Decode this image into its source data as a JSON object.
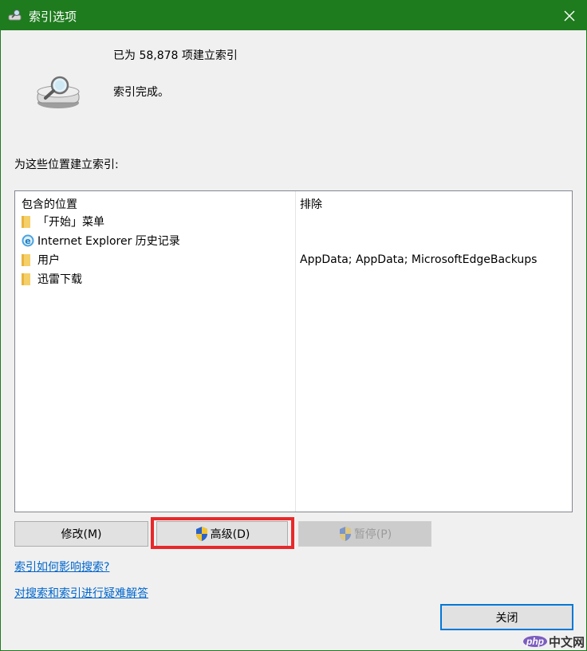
{
  "window": {
    "title": "索引选项",
    "close_glyph": "✕"
  },
  "status": {
    "count_text": "已为 58,878 项建立索引",
    "state_text": "索引完成。"
  },
  "locations": {
    "section_label": "为这些位置建立索引:",
    "headers": {
      "included": "包含的位置",
      "excluded": "排除"
    },
    "rows": [
      {
        "icon": "folder-icon",
        "name": "「开始」菜单",
        "exclude": ""
      },
      {
        "icon": "ie-icon",
        "name": "Internet Explorer 历史记录",
        "exclude": ""
      },
      {
        "icon": "folder-icon",
        "name": "用户",
        "exclude": "AppData; AppData; MicrosoftEdgeBackups"
      },
      {
        "icon": "folder-icon",
        "name": "迅雷下载",
        "exclude": ""
      }
    ]
  },
  "buttons": {
    "modify": "修改(M)",
    "advanced": "高级(D)",
    "pause": "暂停(P)",
    "close": "关闭"
  },
  "links": {
    "how_affects": "索引如何影响搜索?",
    "troubleshoot": "对搜索和索引进行疑难解答"
  },
  "watermark": {
    "logo": "php",
    "text": "中文网"
  },
  "colors": {
    "titlebar": "#1e7b1e",
    "highlight": "#e8282a",
    "link": "#0066cc",
    "default_focus": "#0078d7"
  }
}
